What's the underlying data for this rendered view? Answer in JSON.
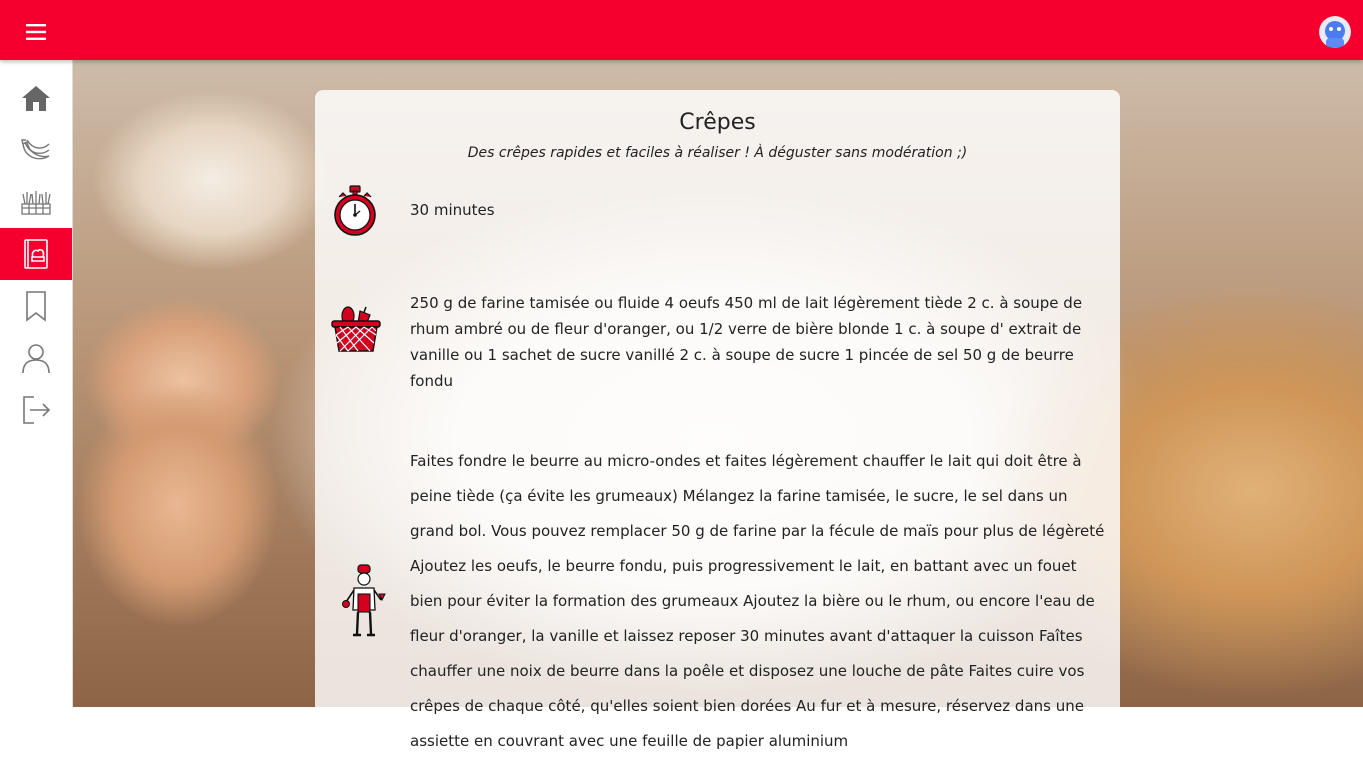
{
  "header": {
    "menu_icon": "hamburger-menu-icon",
    "avatar_icon": "user-avatar-icon",
    "brand_color": "#f5002e"
  },
  "sidebar": {
    "items": [
      {
        "name": "home",
        "icon": "home-icon",
        "active": false
      },
      {
        "name": "bananas",
        "icon": "banana-icon",
        "active": false
      },
      {
        "name": "vegetables",
        "icon": "vegetables-icon",
        "active": false
      },
      {
        "name": "recipes",
        "icon": "recipe-book-icon",
        "active": true
      },
      {
        "name": "bookmarks",
        "icon": "bookmark-icon",
        "active": false
      },
      {
        "name": "profile",
        "icon": "user-icon",
        "active": false
      },
      {
        "name": "logout",
        "icon": "logout-icon",
        "active": false
      }
    ]
  },
  "recipe": {
    "title": "Crêpes",
    "subtitle": "Des crêpes rapides et faciles à réaliser ! À déguster sans modération ;)",
    "time": "30 minutes",
    "ingredients": "250 g de farine tamisée ou fluide 4 oeufs 450 ml de lait légèrement tiède 2 c. à soupe de rhum ambré ou de fleur d'oranger, ou 1/2 verre de bière blonde 1 c. à soupe d' extrait de vanille ou 1 sachet de sucre vanillé 2 c. à soupe de sucre 1 pincée de sel 50 g de beurre fondu",
    "steps": "Faites fondre le beurre au micro-ondes et faites légèrement chauffer le lait qui doit être à peine tiède (ça évite les grumeaux) Mélangez la farine tamisée, le sucre, le sel dans un grand bol. Vous pouvez remplacer 50 g de farine par la fécule de maïs pour plus de légèreté Ajoutez les oeufs, le beurre fondu, puis progressivement le lait, en battant avec un fouet bien pour éviter la formation des grumeaux Ajoutez la bière ou le rhum, ou encore l'eau de fleur d'oranger, la vanille et laissez reposer 30 minutes avant d'attaquer la cuisson Faîtes chauffer une noix de beurre dans la poêle et disposez une louche de pâte Faites cuire vos crêpes de chaque côté, qu'elles soient bien dorées Au fur et à mesure, réservez dans une assiette en couvrant avec une feuille de papier aluminium",
    "icons": {
      "time": "stopwatch-icon",
      "ingredients": "basket-icon",
      "steps": "chef-icon"
    }
  }
}
